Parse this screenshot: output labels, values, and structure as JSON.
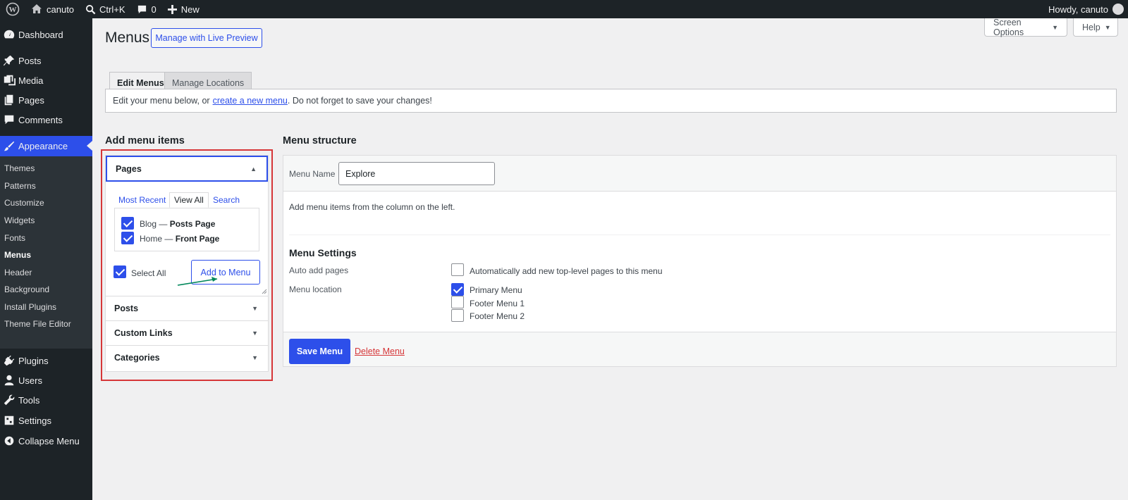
{
  "adminbar": {
    "site_name": "canuto",
    "search_shortcut": "Ctrl+K",
    "comments_count": "0",
    "new_label": "New",
    "howdy": "Howdy, canuto"
  },
  "sidebar": {
    "items": [
      {
        "label": "Dashboard",
        "icon": "dashboard-icon"
      },
      {
        "label": "Posts",
        "icon": "pin-icon"
      },
      {
        "label": "Media",
        "icon": "media-icon"
      },
      {
        "label": "Pages",
        "icon": "pages-icon"
      },
      {
        "label": "Comments",
        "icon": "comment-icon"
      },
      {
        "label": "Appearance",
        "icon": "brush-icon"
      },
      {
        "label": "Plugins",
        "icon": "plug-icon"
      },
      {
        "label": "Users",
        "icon": "user-icon"
      },
      {
        "label": "Tools",
        "icon": "wrench-icon"
      },
      {
        "label": "Settings",
        "icon": "settings-icon"
      },
      {
        "label": "Collapse Menu",
        "icon": "collapse-icon"
      }
    ],
    "submenu": [
      "Themes",
      "Patterns",
      "Customize",
      "Widgets",
      "Fonts",
      "Menus",
      "Header",
      "Background",
      "Install Plugins",
      "Theme File Editor"
    ]
  },
  "header": {
    "screen_options": "Screen Options",
    "help": "Help",
    "title": "Menus",
    "live_preview": "Manage with Live Preview"
  },
  "tabs": [
    "Edit Menus",
    "Manage Locations"
  ],
  "notice": {
    "before": "Edit your menu below, or",
    "link": "create a new menu",
    "after": ". Do not forget to save your changes!"
  },
  "add_items": {
    "title": "Add menu items",
    "sections": [
      "Pages",
      "Posts",
      "Custom Links",
      "Categories"
    ],
    "inner_tabs": [
      "Most Recent",
      "View All",
      "Search"
    ],
    "pages": [
      {
        "prefix": "Blog — ",
        "bold": "Posts Page",
        "checked": true
      },
      {
        "prefix": "Home — ",
        "bold": "Front Page",
        "checked": true
      }
    ],
    "select_all": "Select All",
    "add_button": "Add to Menu"
  },
  "structure": {
    "title": "Menu structure",
    "menu_name_label": "Menu Name",
    "menu_name_value": "Explore",
    "instructions": "Add menu items from the column on the left.",
    "settings_title": "Menu Settings",
    "auto_add_label": "Auto add pages",
    "auto_add_option": "Automatically add new top-level pages to this menu",
    "location_label": "Menu location",
    "locations": [
      {
        "label": "Primary Menu",
        "checked": true
      },
      {
        "label": "Footer Menu 1",
        "checked": false
      },
      {
        "label": "Footer Menu 2",
        "checked": false
      }
    ],
    "save_button": "Save Menu",
    "delete_link": "Delete Menu"
  },
  "colors": {
    "accent": "#2d4fea",
    "highlight": "#d63638",
    "annotation_arrow": "#00875a"
  }
}
